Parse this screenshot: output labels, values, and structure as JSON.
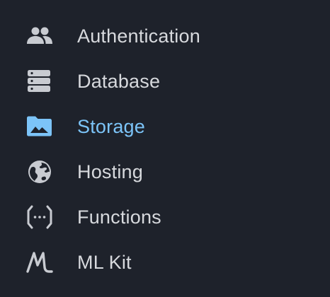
{
  "colors": {
    "background": "#1e222b",
    "text": "#d7d9dd",
    "icon": "#c8cbd1",
    "active": "#7cc4f8"
  },
  "sidebar": {
    "items": [
      {
        "label": "Authentication",
        "icon": "people-icon",
        "active": false
      },
      {
        "label": "Database",
        "icon": "database-icon",
        "active": false
      },
      {
        "label": "Storage",
        "icon": "folder-image-icon",
        "active": true
      },
      {
        "label": "Hosting",
        "icon": "globe-icon",
        "active": false
      },
      {
        "label": "Functions",
        "icon": "functions-icon",
        "active": false
      },
      {
        "label": "ML Kit",
        "icon": "ml-kit-icon",
        "active": false
      }
    ]
  }
}
